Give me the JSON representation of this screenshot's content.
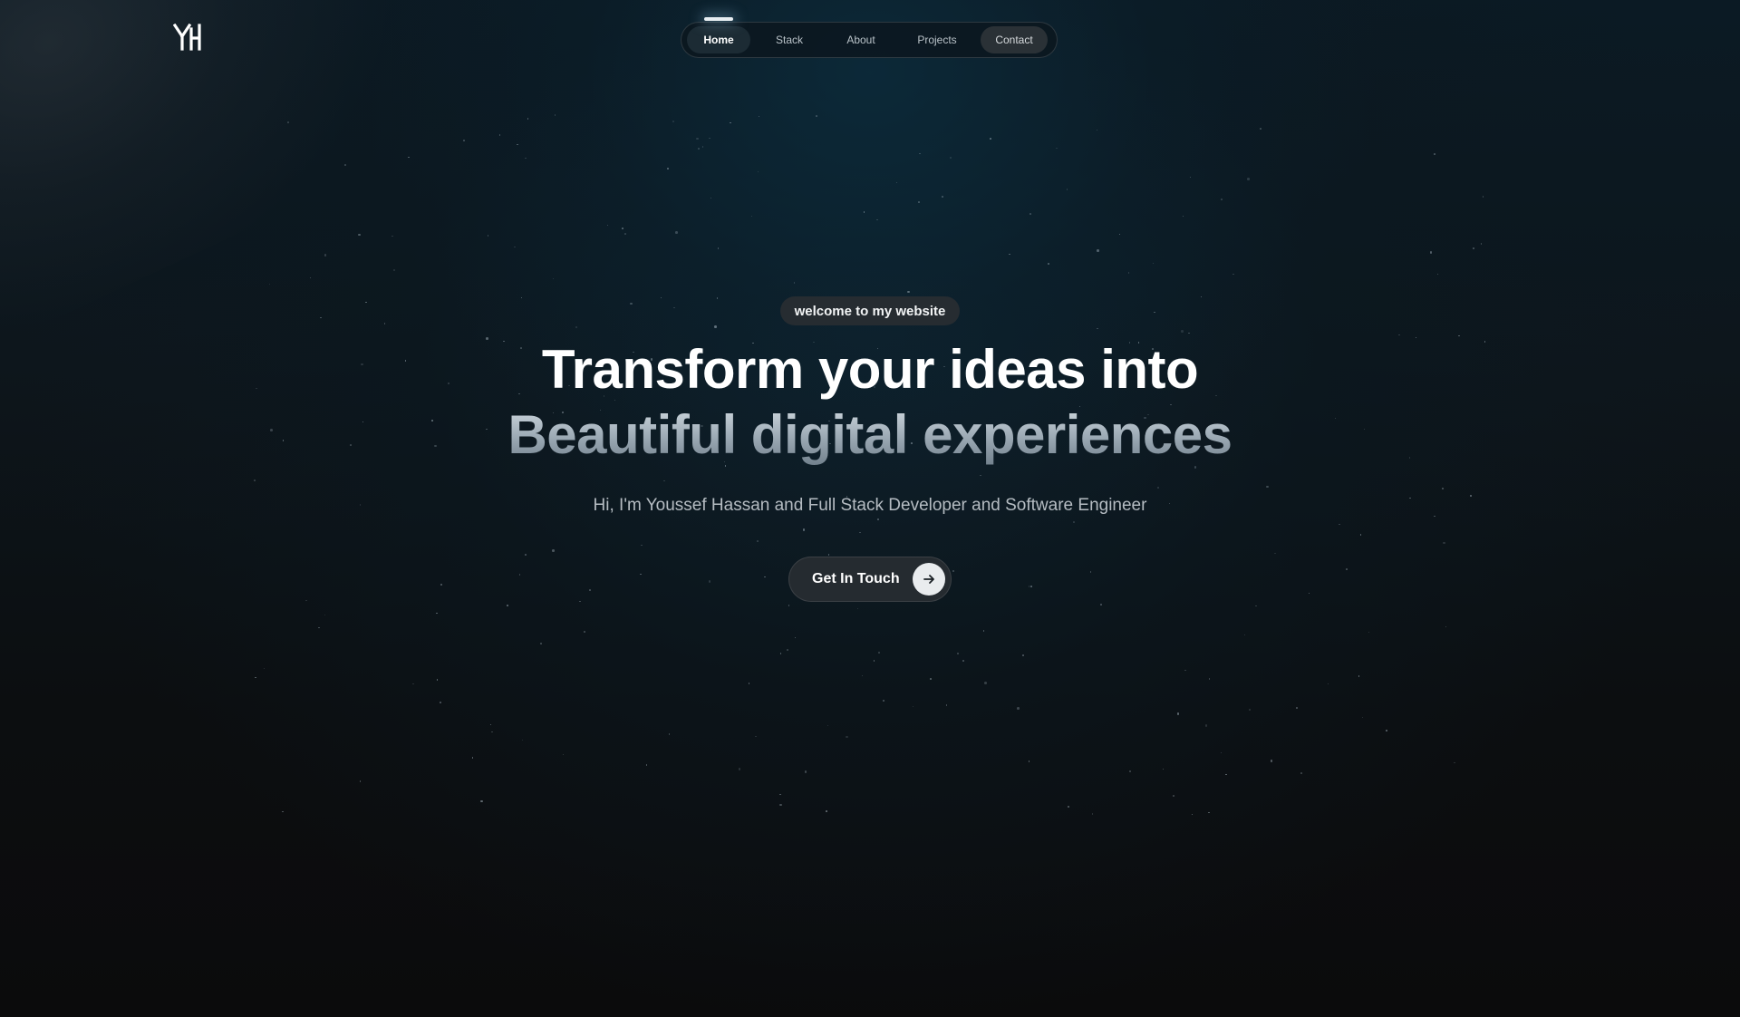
{
  "logo": {
    "text": "YH",
    "icon": "yh-monogram-logo"
  },
  "nav": {
    "items": [
      {
        "label": "Home",
        "active": true
      },
      {
        "label": "Stack",
        "active": false
      },
      {
        "label": "About",
        "active": false
      },
      {
        "label": "Projects",
        "active": false
      },
      {
        "label": "Contact",
        "active": false
      }
    ]
  },
  "hero": {
    "badge": "welcome to my website",
    "headline_line1": "Transform your ideas into",
    "headline_line2": "Beautiful digital experiences",
    "subtitle": "Hi, I'm Youssef Hassan and Full Stack Developer and Software Engineer",
    "cta_label": "Get In Touch",
    "cta_icon": "arrow-right-icon"
  },
  "colors": {
    "background": "#0b0c0d",
    "accent_glow": "#0c3448",
    "button_bg": "#252b30",
    "badge_bg": "#262c31"
  }
}
